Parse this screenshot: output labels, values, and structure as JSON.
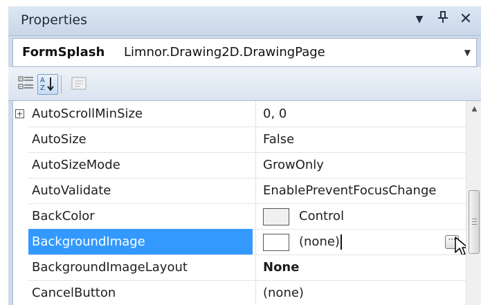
{
  "panel": {
    "title": "Properties",
    "dropdown_icon": "dropdown-arrow-icon",
    "pin_icon": "pin-icon",
    "close_icon": "close-icon"
  },
  "object_selector": {
    "name": "FormSplash",
    "type": "Limnor.Drawing2D.DrawingPage"
  },
  "toolbar": {
    "buttons": [
      {
        "icon": "categorized-icon",
        "selected": false
      },
      {
        "icon": "alphabetical-icon",
        "selected": true
      },
      {
        "icon": "property-pages-icon",
        "selected": false
      }
    ]
  },
  "colors": {
    "selection": "#3399ff",
    "header": "#cfdbe9"
  },
  "properties": [
    {
      "name": "AutoScrollMinSize",
      "value": "0, 0",
      "expandable": true
    },
    {
      "name": "AutoSize",
      "value": "False"
    },
    {
      "name": "AutoSizeMode",
      "value": "GrowOnly"
    },
    {
      "name": "AutoValidate",
      "value": "EnablePreventFocusChange"
    },
    {
      "name": "BackColor",
      "value": "Control",
      "swatch": "#f0f0f0"
    },
    {
      "name": "BackgroundImage",
      "value": "(none)",
      "swatch": "#ffffff",
      "selected": true
    },
    {
      "name": "BackgroundImageLayout",
      "value": "None",
      "bold": true
    },
    {
      "name": "CancelButton",
      "value": "(none)"
    }
  ]
}
